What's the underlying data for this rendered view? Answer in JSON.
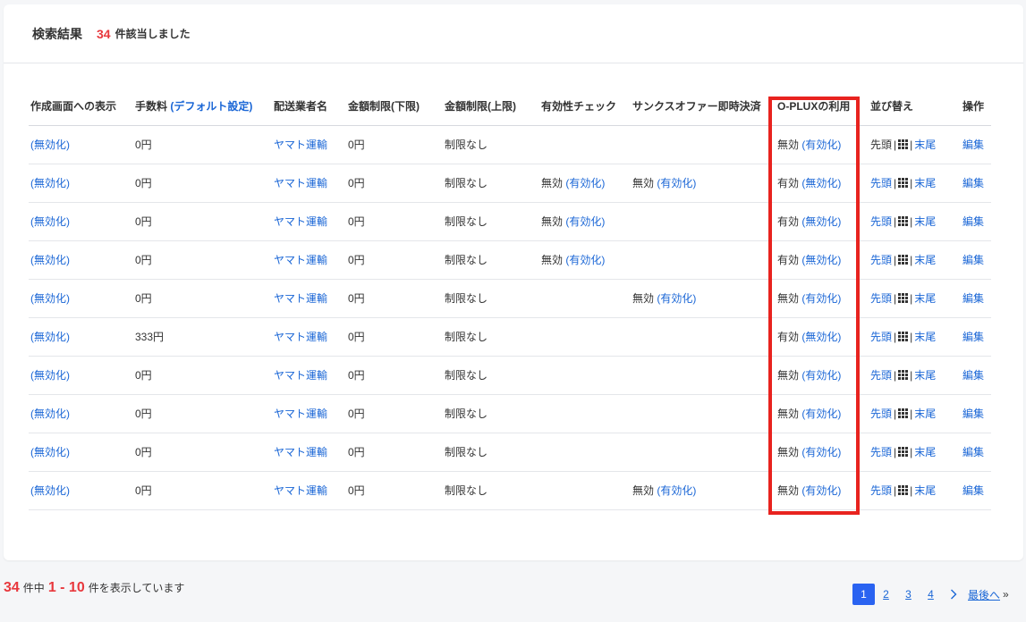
{
  "header": {
    "title": "検索結果",
    "count": "34",
    "count_suffix": "件該当しました"
  },
  "columns": [
    "作成画面への表示",
    "手数料",
    "(デフォルト設定)",
    "配送業者名",
    "金額制限(下限)",
    "金額制限(上限)",
    "有効性チェック",
    "サンクスオファー即時決済",
    "O-PLUXの利用",
    "並び替え",
    "操作"
  ],
  "labels": {
    "disabled_link": "(無効化)",
    "enabled_link": "(有効化)",
    "sort_top": "先頭",
    "sort_bottom": "末尾",
    "pipe": "|",
    "edit": "編集"
  },
  "rows": [
    {
      "display": "(無効化)",
      "fee": "0円",
      "carrier": "ヤマト運輸",
      "min": "0円",
      "max": "制限なし",
      "validity_status": "",
      "validity_link": "",
      "thanks_status": "",
      "thanks_link": "",
      "oplux_status": "無効",
      "oplux_link": "(有効化)",
      "top_is_link": false
    },
    {
      "display": "(無効化)",
      "fee": "0円",
      "carrier": "ヤマト運輸",
      "min": "0円",
      "max": "制限なし",
      "validity_status": "無効",
      "validity_link": "(有効化)",
      "thanks_status": "無効",
      "thanks_link": "(有効化)",
      "oplux_status": "有効",
      "oplux_link": "(無効化)",
      "top_is_link": true
    },
    {
      "display": "(無効化)",
      "fee": "0円",
      "carrier": "ヤマト運輸",
      "min": "0円",
      "max": "制限なし",
      "validity_status": "無効",
      "validity_link": "(有効化)",
      "thanks_status": "",
      "thanks_link": "",
      "oplux_status": "有効",
      "oplux_link": "(無効化)",
      "top_is_link": true
    },
    {
      "display": "(無効化)",
      "fee": "0円",
      "carrier": "ヤマト運輸",
      "min": "0円",
      "max": "制限なし",
      "validity_status": "無効",
      "validity_link": "(有効化)",
      "thanks_status": "",
      "thanks_link": "",
      "oplux_status": "有効",
      "oplux_link": "(無効化)",
      "top_is_link": true
    },
    {
      "display": "(無効化)",
      "fee": "0円",
      "carrier": "ヤマト運輸",
      "min": "0円",
      "max": "制限なし",
      "validity_status": "",
      "validity_link": "",
      "thanks_status": "無効",
      "thanks_link": "(有効化)",
      "oplux_status": "無効",
      "oplux_link": "(有効化)",
      "top_is_link": true
    },
    {
      "display": "(無効化)",
      "fee": "333円",
      "carrier": "ヤマト運輸",
      "min": "0円",
      "max": "制限なし",
      "validity_status": "",
      "validity_link": "",
      "thanks_status": "",
      "thanks_link": "",
      "oplux_status": "有効",
      "oplux_link": "(無効化)",
      "top_is_link": true
    },
    {
      "display": "(無効化)",
      "fee": "0円",
      "carrier": "ヤマト運輸",
      "min": "0円",
      "max": "制限なし",
      "validity_status": "",
      "validity_link": "",
      "thanks_status": "",
      "thanks_link": "",
      "oplux_status": "無効",
      "oplux_link": "(有効化)",
      "top_is_link": true
    },
    {
      "display": "(無効化)",
      "fee": "0円",
      "carrier": "ヤマト運輸",
      "min": "0円",
      "max": "制限なし",
      "validity_status": "",
      "validity_link": "",
      "thanks_status": "",
      "thanks_link": "",
      "oplux_status": "無効",
      "oplux_link": "(有効化)",
      "top_is_link": true
    },
    {
      "display": "(無効化)",
      "fee": "0円",
      "carrier": "ヤマト運輸",
      "min": "0円",
      "max": "制限なし",
      "validity_status": "",
      "validity_link": "",
      "thanks_status": "",
      "thanks_link": "",
      "oplux_status": "無効",
      "oplux_link": "(有効化)",
      "top_is_link": true
    },
    {
      "display": "(無効化)",
      "fee": "0円",
      "carrier": "ヤマト運輸",
      "min": "0円",
      "max": "制限なし",
      "validity_status": "",
      "validity_link": "",
      "thanks_status": "無効",
      "thanks_link": "(有効化)",
      "oplux_status": "無効",
      "oplux_link": "(有効化)",
      "top_is_link": true
    }
  ],
  "footer": {
    "total": "34",
    "mid_text": "件中",
    "range": "1 - 10",
    "end_text": "件を表示しています"
  },
  "pagination": {
    "pages": [
      "1",
      "2",
      "3",
      "4"
    ],
    "active": "1",
    "next_icon": "chevron-right-icon",
    "last_label": "最後へ",
    "last_suffix": "»"
  },
  "colors": {
    "accent": "#1a66d6",
    "count_red": "#e8383d",
    "highlight_red": "#e8231f",
    "page_active": "#2a63f1"
  }
}
